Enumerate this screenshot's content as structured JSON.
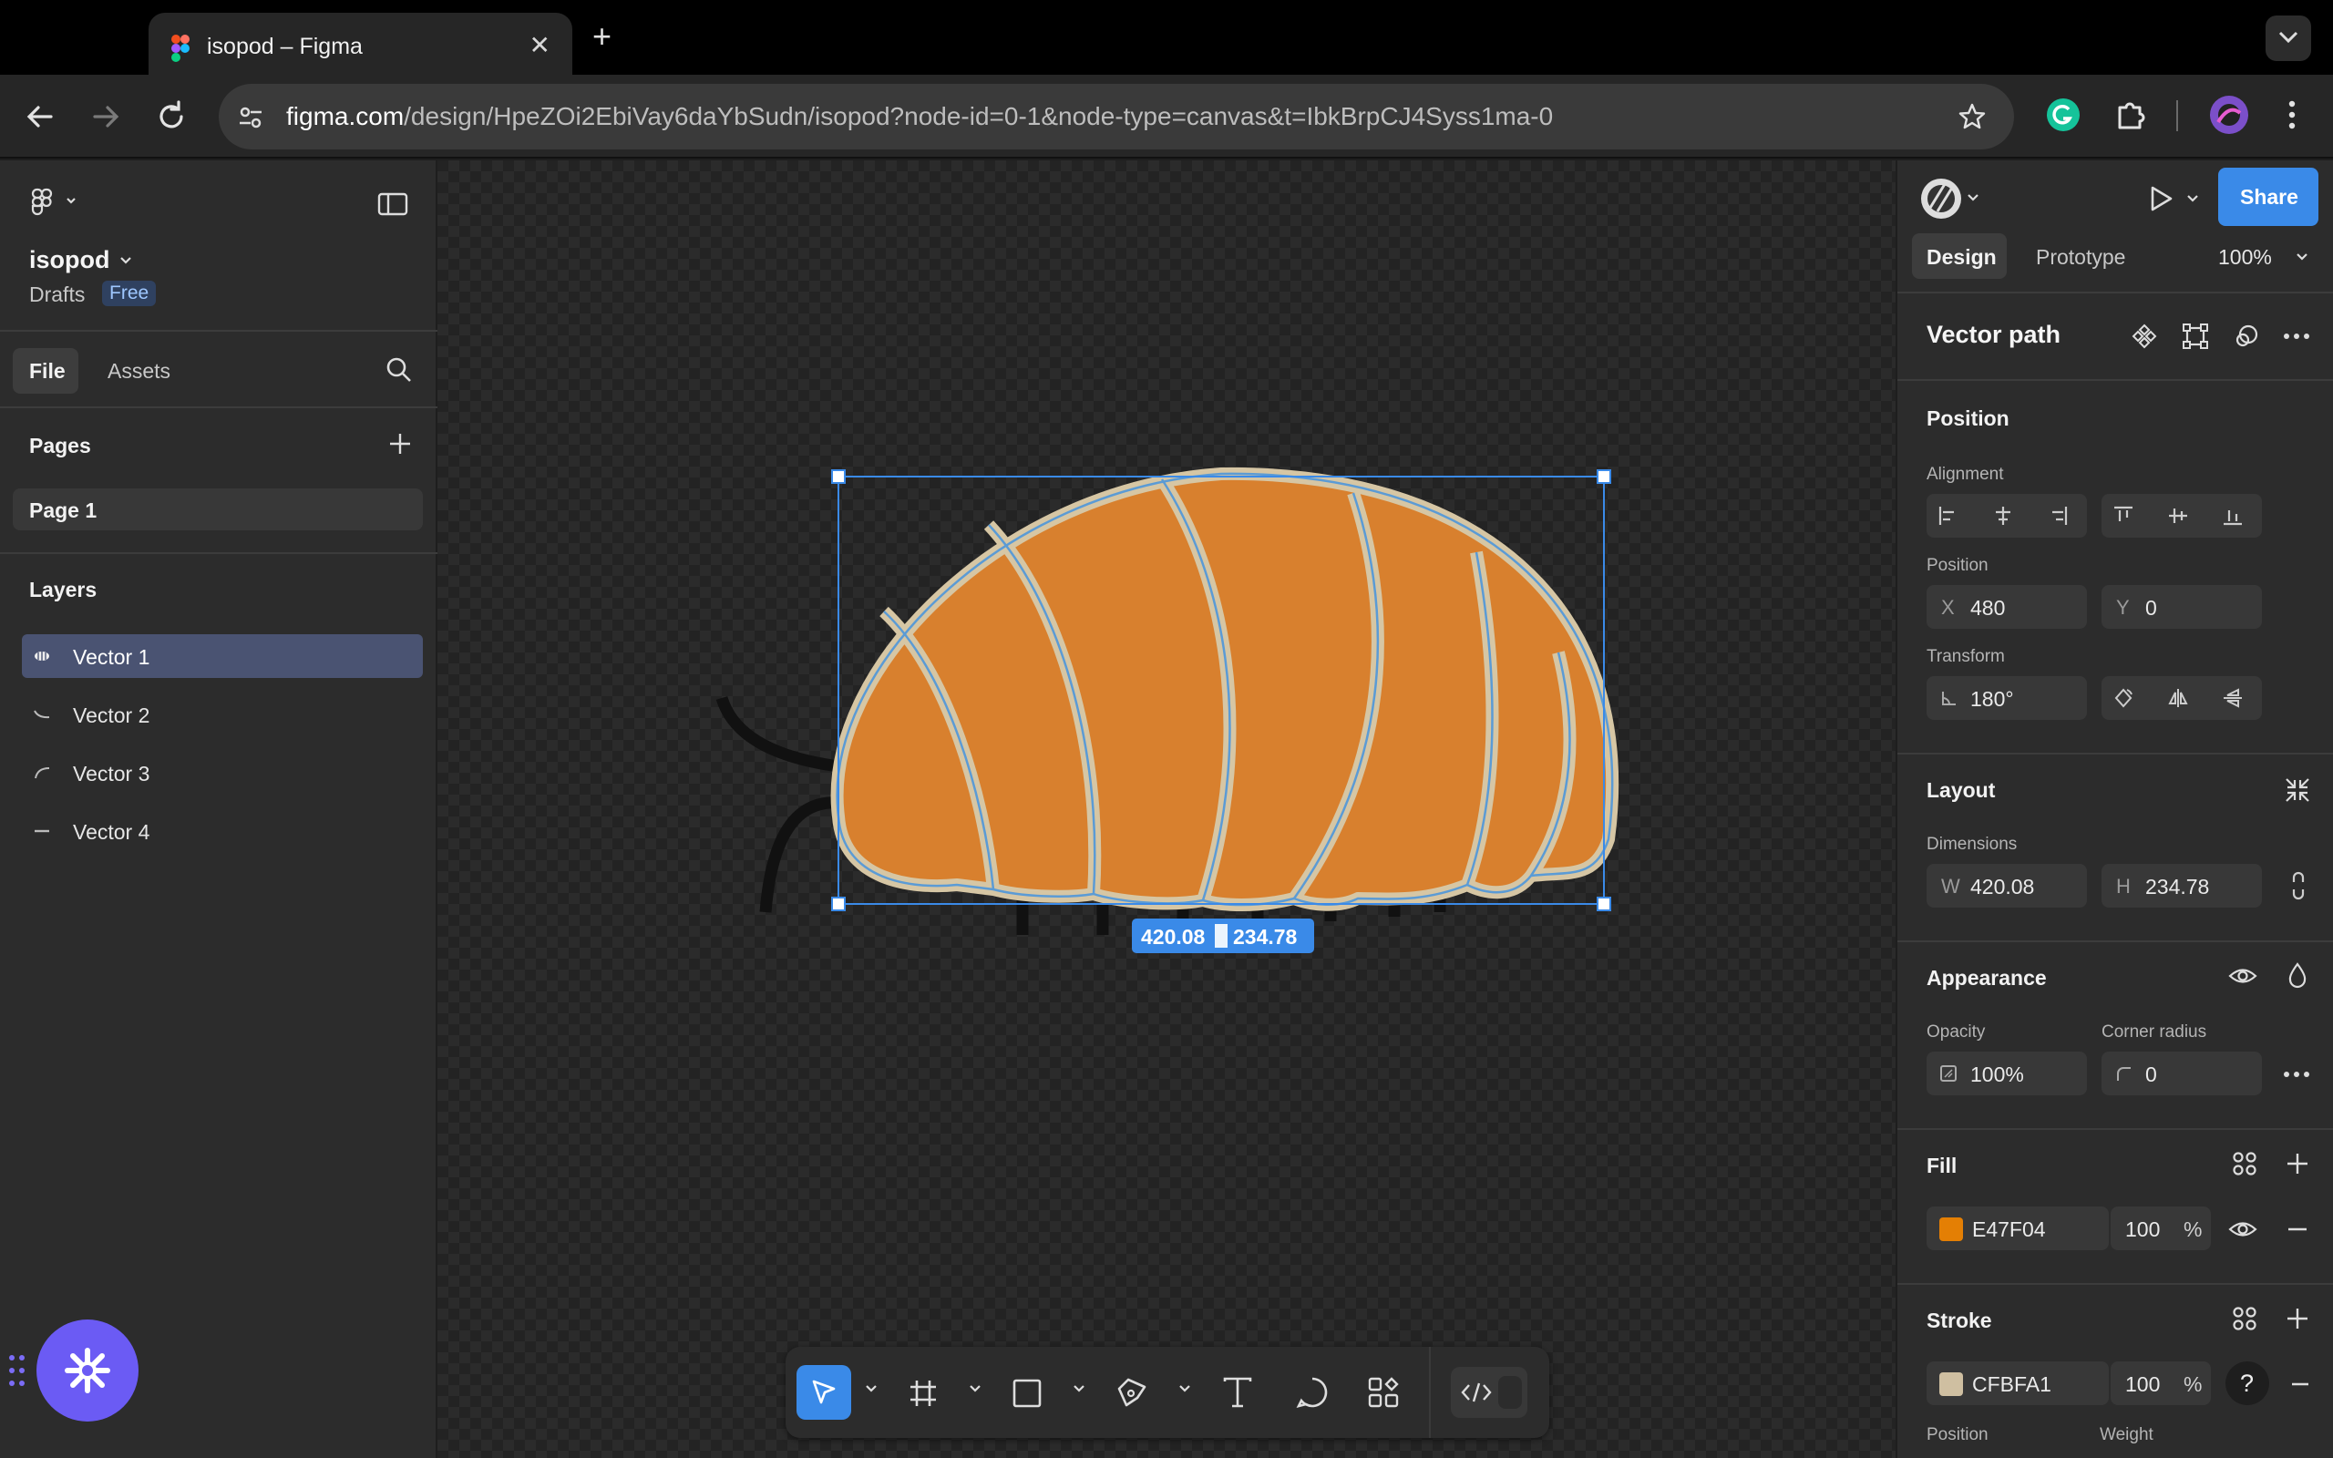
{
  "browser": {
    "tab_title": "isopod – Figma",
    "url_host": "figma.com",
    "url_path": "/design/HpeZOi2EbiVay6daYbSudn/isopod?node-id=0-1&node-type=canvas&t=IbkBrpCJ4Syss1ma-0"
  },
  "file": {
    "name": "isopod",
    "location": "Drafts",
    "plan_badge": "Free"
  },
  "left_tabs": {
    "file": "File",
    "assets": "Assets"
  },
  "pages": {
    "header": "Pages",
    "items": [
      "Page 1"
    ]
  },
  "layers": {
    "header": "Layers",
    "items": [
      "Vector 1",
      "Vector 2",
      "Vector 3",
      "Vector 4"
    ],
    "selected": "Vector 1"
  },
  "canvas": {
    "size_label": "420.08 × 234.78",
    "selection_width_label": "420.08",
    "selection_height_label": "234.78"
  },
  "header_right": {
    "share": "Share",
    "zoom": "100%"
  },
  "mode_tabs": {
    "design": "Design",
    "prototype": "Prototype"
  },
  "selection_title": "Vector path",
  "position_section": {
    "header": "Position",
    "alignment_label": "Alignment",
    "position_label": "Position",
    "x_prefix": "X",
    "x": "480",
    "y_prefix": "Y",
    "y": "0",
    "transform_label": "Transform",
    "rotation": "180°"
  },
  "layout_section": {
    "header": "Layout",
    "dimensions_label": "Dimensions",
    "w_prefix": "W",
    "w": "420.08",
    "h_prefix": "H",
    "h": "234.78"
  },
  "appearance_section": {
    "header": "Appearance",
    "opacity_label": "Opacity",
    "opacity": "100%",
    "corner_label": "Corner radius",
    "corner": "0"
  },
  "fill_section": {
    "header": "Fill",
    "hex": "E47F04",
    "opacity": "100",
    "unit": "%",
    "swatch_color": "#E47F04"
  },
  "stroke_section": {
    "header": "Stroke",
    "hex": "CFBFA1",
    "opacity": "100",
    "unit": "%",
    "swatch_color": "#CFBFA1",
    "position_label": "Position",
    "weight_label": "Weight"
  },
  "help": "?",
  "colors": {
    "accent": "#0d99ff",
    "share_button": "#3a8ae8",
    "isopod_fill": "#D8802E",
    "isopod_stroke": "#D6C6A4",
    "selection": "#3a8ae8",
    "float_button": "#6b5bf4"
  }
}
